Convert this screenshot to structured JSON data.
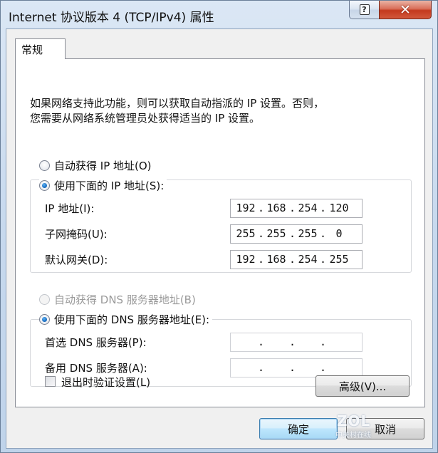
{
  "window": {
    "title": "Internet 协议版本 4 (TCP/IPv4) 属性",
    "help_glyph": "?",
    "close_glyph": "✕"
  },
  "tabs": [
    {
      "label": "常规",
      "selected": true
    }
  ],
  "description": {
    "line1": "如果网络支持此功能，则可以获取自动指派的 IP 设置。否则，",
    "line2": "您需要从网络系统管理员处获得适当的 IP 设置。"
  },
  "ip_section": {
    "auto_radio": {
      "label": "自动获得 IP 地址(O)",
      "checked": false
    },
    "manual_radio": {
      "label": "使用下面的 IP 地址(S):",
      "checked": true
    },
    "fields": [
      {
        "label": "IP 地址(I):",
        "octets": [
          "192",
          "168",
          "254",
          "120"
        ]
      },
      {
        "label": "子网掩码(U):",
        "octets": [
          "255",
          "255",
          "255",
          "0"
        ]
      },
      {
        "label": "默认网关(D):",
        "octets": [
          "192",
          "168",
          "254",
          "255"
        ]
      }
    ]
  },
  "dns_section": {
    "auto_radio": {
      "label": "自动获得 DNS 服务器地址(B)",
      "checked": false,
      "disabled": true
    },
    "manual_radio": {
      "label": "使用下面的 DNS 服务器地址(E):",
      "checked": true
    },
    "fields": [
      {
        "label": "首选 DNS 服务器(P):",
        "octets": [
          "",
          "",
          "",
          ""
        ]
      },
      {
        "label": "备用 DNS 服务器(A):",
        "octets": [
          "",
          "",
          "",
          ""
        ]
      }
    ]
  },
  "validate_checkbox": {
    "label": "退出时验证设置(L)",
    "checked": false
  },
  "buttons": {
    "advanced": "高级(V)...",
    "ok": "确定",
    "cancel": "取消"
  },
  "watermark": {
    "logo": "ZOL",
    "sub": "中关村在线"
  },
  "colors": {
    "radio_selected": "#1b6fc4",
    "close_button": "#c4391e",
    "default_button_border": "#3c7fb1"
  }
}
